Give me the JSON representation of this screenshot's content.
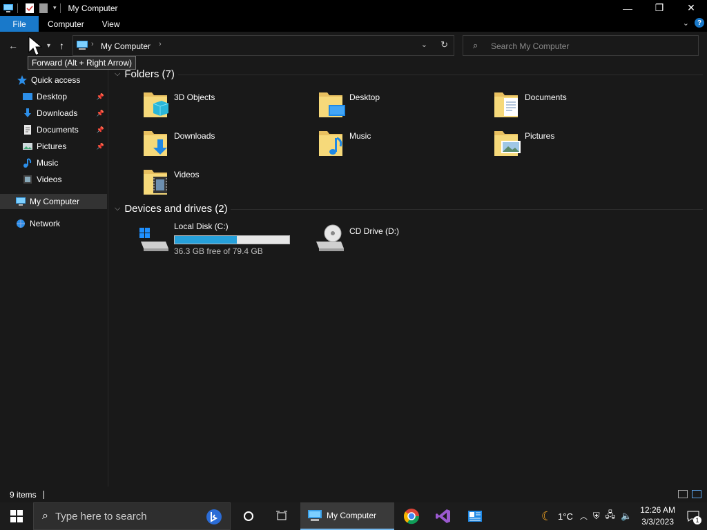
{
  "window": {
    "title": "My Computer",
    "controls": {
      "minimize": "—",
      "maximize": "❐",
      "close": "✕"
    }
  },
  "ribbon": {
    "tabs": [
      {
        "label": "File"
      },
      {
        "label": "Computer"
      },
      {
        "label": "View"
      }
    ],
    "help": "?"
  },
  "address": {
    "crumb": "My Computer",
    "tooltip": "Forward (Alt + Right Arrow)"
  },
  "search": {
    "placeholder": "Search My Computer"
  },
  "sidebar": {
    "quick_access": "Quick access",
    "items": [
      {
        "label": "Desktop",
        "pinned": true
      },
      {
        "label": "Downloads",
        "pinned": true
      },
      {
        "label": "Documents",
        "pinned": true
      },
      {
        "label": "Pictures",
        "pinned": true
      },
      {
        "label": "Music",
        "pinned": false
      },
      {
        "label": "Videos",
        "pinned": false
      }
    ],
    "this_pc": "My Computer",
    "network": "Network"
  },
  "content": {
    "folders_header": "Folders (7)",
    "folders": [
      {
        "label": "3D Objects"
      },
      {
        "label": "Desktop"
      },
      {
        "label": "Documents"
      },
      {
        "label": "Downloads"
      },
      {
        "label": "Music"
      },
      {
        "label": "Pictures"
      },
      {
        "label": "Videos"
      }
    ],
    "drives_header": "Devices and drives (2)",
    "drives": [
      {
        "label": "Local Disk (C:)",
        "free": "36.3 GB free of 79.4 GB",
        "used_fraction": 0.54
      },
      {
        "label": "CD Drive (D:)"
      }
    ]
  },
  "status": {
    "items": "9 items"
  },
  "taskbar": {
    "search_placeholder": "Type here to search",
    "active_app": "My Computer",
    "temperature": "1°C",
    "time": "12:26 AM",
    "date": "3/3/2023",
    "notifications": "1"
  }
}
